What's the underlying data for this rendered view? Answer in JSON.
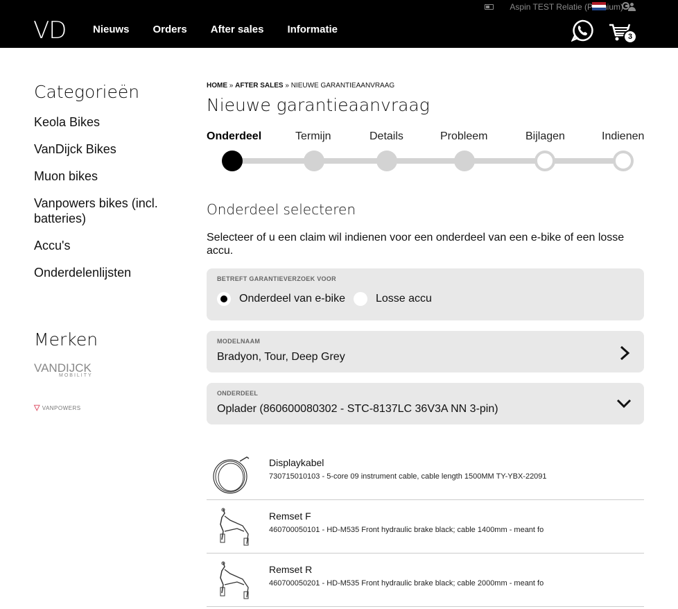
{
  "header": {
    "logo": "VD",
    "user": "Aspin TEST Relatie (Premium)",
    "nav": [
      "Nieuws",
      "Orders",
      "After sales",
      "Informatie"
    ],
    "cart_count": "3"
  },
  "sidebar": {
    "categories_title": "Categorieën",
    "categories": [
      "Keola Bikes",
      "VanDijck Bikes",
      "Muon bikes",
      "Vanpowers bikes (incl. batteries)",
      "Accu's",
      "Onderdelenlijsten"
    ],
    "brands_title": "Merken",
    "brand1": "VANDIJCK",
    "brand1_sub": "MOBILITY",
    "brand2": "VANPOWERS"
  },
  "breadcrumb": {
    "home": "HOME",
    "sep": " » ",
    "after_sales": "AFTER SALES",
    "current": "NIEUWE GARANTIEAANVRAAG"
  },
  "page_title": "Nieuwe garantieaanvraag",
  "steps": {
    "labels": [
      "Onderdeel",
      "Termijn",
      "Details",
      "Probleem",
      "Bijlagen",
      "Indienen"
    ],
    "states": [
      "active",
      "filled",
      "filled",
      "filled",
      "open",
      "open"
    ]
  },
  "section_title": "Onderdeel selecteren",
  "intro": "Selecteer of u een claim wil indienen voor een onderdeel van een e-bike of een losse accu.",
  "claim_for": {
    "label": "BETREFT GARANTIEVERZOEK VOOR",
    "options": [
      "Onderdeel van e-bike",
      "Losse accu"
    ],
    "selected": 0
  },
  "model": {
    "label": "MODELNAAM",
    "value": "Bradyon, Tour, Deep Grey"
  },
  "part": {
    "label": "ONDERDEEL",
    "value": "Oplader (860600080302 - STC-8137LC 36V3A NN 3-pin)"
  },
  "items": [
    {
      "name": "Displaykabel",
      "desc": "730715010103 - 5-core 09 instrument cable, cable length 1500MM TY-YBX-22091",
      "icon": "cable-icon"
    },
    {
      "name": "Remset F",
      "desc": "460700050101 - HD-M535 Front hydraulic brake black; cable 1400mm - meant fo",
      "icon": "brake-icon"
    },
    {
      "name": "Remset R",
      "desc": "460700050201 - HD-M535 Front hydraulic brake black; cable 2000mm - meant fo",
      "icon": "brake-icon"
    }
  ],
  "colors": {
    "header_bg": "#000000",
    "panel_bg": "#e8e8e8",
    "track": "#d3d3d3"
  }
}
